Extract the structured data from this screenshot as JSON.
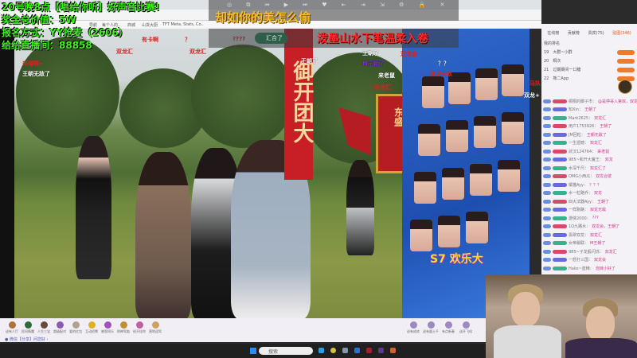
{
  "overlay_info": [
    "20号晚8点【唱给你听】好声音比赛!",
    "奖金总价值：5W",
    "报名方式：YY抢麦（2606）",
    "给给直播间：88858"
  ],
  "browser": {
    "bookmarks": [
      "导航",
      "每个人的..",
      "商城",
      "山货大厨",
      "TFT Meta, Stats, Co.."
    ]
  },
  "player": {
    "controls": "◎ ⧉ ⏮ ▶ ⏭ ♥ ⇤ ⇥ ⇲ ⚙ 🔒 ✕",
    "lyric_top": "却如你的美怎么偷",
    "lyric_bottom": "泼墨山水下笔温柔入卷",
    "merge_badge": "汇合了"
  },
  "video": {
    "pole_text": "御开团大",
    "flag_text": "东盛",
    "poster_logo": "S7 欢乐大"
  },
  "danmaku": [
    "有卡啊",
    "？",
    "双龙汇",
    "双龙汇",
    "????",
    "王朝了",
    "王朝了",
    "双龙会",
    "双龙无敌",
    "M王朝了",
    "王朝无敌了",
    "来哦啊~",
    "来老鼠",
    "？？",
    "双龙汇",
    "双龙+",
    "马队"
  ],
  "chat": {
    "tabs": [
      "在线榜",
      "贡献榜",
      "贵宾(75)",
      "贴图(346)"
    ],
    "my_rank": "我的排名",
    "top_users": [
      {
        "rank": "19",
        "name": "大群~小群"
      },
      {
        "rank": "20",
        "name": "桐次"
      },
      {
        "rank": "21",
        "name": "过期期间一口糖"
      },
      {
        "rank": "22",
        "name": "熊二App"
      }
    ],
    "messages": [
      {
        "name": "桐桐的脚子市：",
        "text": "@是停哥入第双，双龙汇"
      },
      {
        "name": "知Xin：",
        "text": "王朝了"
      },
      {
        "name": "Mark2625：",
        "text": "双龙汇"
      },
      {
        "name": "用户1753926：",
        "text": "王朝了"
      },
      {
        "name": "JM回粒：",
        "text": "王朝无敌了"
      },
      {
        "name": "一生遗憾：",
        "text": "双龙汇"
      },
      {
        "name": "武汉124764：",
        "text": "来老鼠"
      },
      {
        "name": "985~和开大魔王：",
        "text": "双龙"
      },
      {
        "name": "水深千尺：",
        "text": "双龙汇了"
      },
      {
        "name": "OMG小西瓜：",
        "text": "双龙合璧"
      },
      {
        "name": "橘猫Ayy：",
        "text": "？？？"
      },
      {
        "name": "水一粒路乔：",
        "text": "双龙"
      },
      {
        "name": "四大法器Ayy：",
        "text": "王朝了"
      },
      {
        "name": "一样跑路：",
        "text": "双龙无敌"
      },
      {
        "name": "游侠2000：",
        "text": "???"
      },
      {
        "name": "1Q九路水：",
        "text": "双龙会，王朝了"
      },
      {
        "name": "翡翠双龙：",
        "text": "双龙汇"
      },
      {
        "name": "女帝踢联：",
        "text": "M王朝了"
      },
      {
        "name": "985~子龙般闪烁：",
        "text": "双龙汇"
      },
      {
        "name": "一怒打三国：",
        "text": "双龙会"
      },
      {
        "name": "Hako~蓝精：",
        "text": "泡妹小好了"
      }
    ]
  },
  "gifts": [
    "送有人厅",
    "民间情魔",
    "人生三宝",
    "超级配对",
    "爱的红包",
    "互动招牌",
    "感恩同乐",
    "财神驾临",
    "给开挂你",
    "营地迎驾"
  ],
  "gifts_right": [
    "送有成欢",
    "送有量土千",
    "有点新春",
    "送开飞机"
  ],
  "notice": "● 微信【分享】问您好 ›",
  "taskbar": {
    "search_placeholder": "搜索"
  }
}
